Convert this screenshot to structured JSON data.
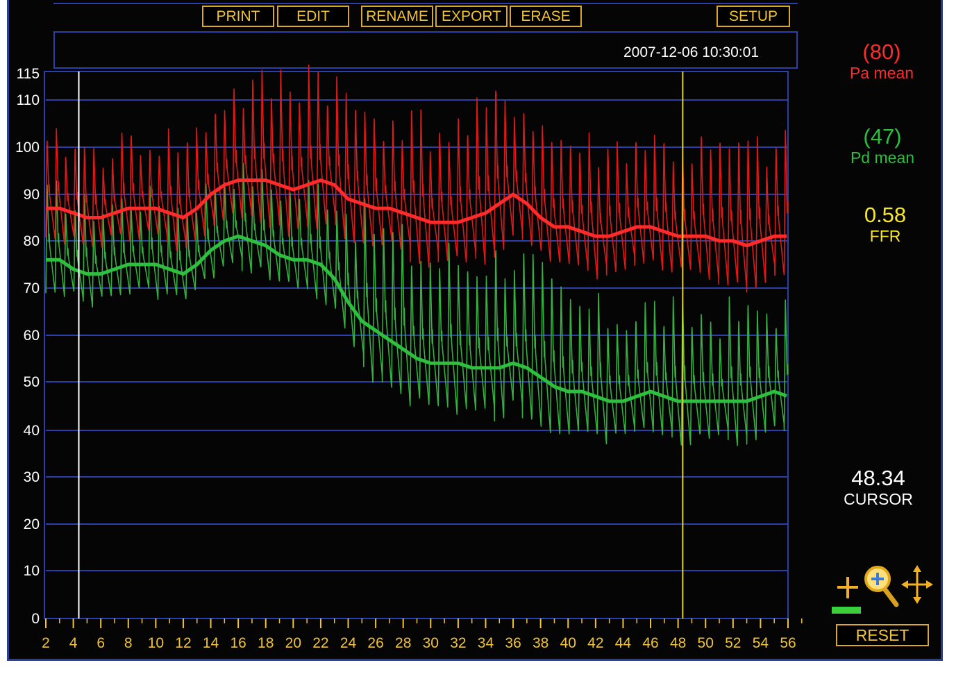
{
  "toolbar": {
    "print_label": "PRINT",
    "edit_label": "EDIT",
    "rename_label": "RENAME",
    "export_label": "EXPORT",
    "erase_label": "ERASE",
    "setup_label": "SETUP"
  },
  "header": {
    "timestamp": "2007-12-06 10:30:01"
  },
  "readouts": {
    "pa_value": "(80)",
    "pa_label": "Pa mean",
    "pd_value": "(47)",
    "pd_label": "Pd mean",
    "ffr_value": "0.58",
    "ffr_label": "FFR",
    "cursor_value": "48.34",
    "cursor_label": "CURSOR"
  },
  "controls": {
    "reset_label": "RESET",
    "zoom_in_icon": "plus-icon",
    "zoom_icon": "magnifier-icon",
    "pan_icon": "move-arrows-icon"
  },
  "colors": {
    "pa": "#ff2a2a",
    "pa_wave": "#e01818",
    "pd": "#2fbf3f",
    "pd_wave": "#35b040",
    "ffr": "#f5e82a",
    "accent": "#f2c336",
    "grid": "#2a3fa8"
  },
  "chart_data": {
    "type": "line",
    "x_ticks": [
      "2",
      "4",
      "6",
      "8",
      "10",
      "12",
      "14",
      "16",
      "18",
      "20",
      "22",
      "24",
      "26",
      "28",
      "30",
      "32",
      "34",
      "36",
      "38",
      "40",
      "42",
      "44",
      "46",
      "48",
      "50",
      "52",
      "54",
      "56"
    ],
    "y_ticks": [
      "0",
      "10",
      "20",
      "30",
      "40",
      "50",
      "60",
      "70",
      "80",
      "90",
      "100",
      "110",
      "115"
    ],
    "xlim": [
      2,
      56
    ],
    "ylim": [
      0,
      115
    ],
    "grid": true,
    "white_cursor_x": 4.4,
    "yellow_cursor_x": 48.34,
    "series": [
      {
        "name": "Pa mean",
        "x": [
          2,
          3,
          4,
          5,
          6,
          7,
          8,
          9,
          10,
          11,
          12,
          13,
          14,
          15,
          16,
          17,
          18,
          19,
          20,
          21,
          22,
          23,
          24,
          25,
          26,
          27,
          28,
          29,
          30,
          31,
          32,
          33,
          34,
          35,
          36,
          37,
          38,
          39,
          40,
          41,
          42,
          43,
          44,
          45,
          46,
          47,
          48,
          49,
          50,
          51,
          52,
          53,
          54,
          55,
          56
        ],
        "y": [
          87,
          87,
          86,
          85,
          85,
          86,
          87,
          87,
          87,
          86,
          85,
          87,
          90,
          92,
          93,
          93,
          93,
          92,
          91,
          92,
          93,
          92,
          89,
          88,
          87,
          87,
          86,
          85,
          84,
          84,
          84,
          85,
          86,
          88,
          90,
          88,
          85,
          83,
          83,
          82,
          81,
          81,
          82,
          83,
          83,
          82,
          81,
          81,
          81,
          80,
          80,
          79,
          80,
          81,
          81
        ],
        "wave_amplitude": [
          9,
          10,
          10,
          10,
          10,
          10,
          10,
          10,
          10,
          11,
          11,
          11,
          12,
          13,
          13,
          13,
          14,
          15,
          16,
          17,
          16,
          15,
          14,
          14,
          14,
          14,
          14,
          14,
          14,
          14,
          14,
          14,
          15,
          15,
          15,
          14,
          14,
          13,
          13,
          13,
          13,
          13,
          13,
          13,
          13,
          13,
          13,
          13,
          13,
          13,
          14,
          14,
          14,
          13,
          13
        ]
      },
      {
        "name": "Pd mean",
        "x": [
          2,
          3,
          4,
          5,
          6,
          7,
          8,
          9,
          10,
          11,
          12,
          13,
          14,
          15,
          16,
          17,
          18,
          19,
          20,
          21,
          22,
          23,
          24,
          25,
          26,
          27,
          28,
          29,
          30,
          31,
          32,
          33,
          34,
          35,
          36,
          37,
          38,
          39,
          40,
          41,
          42,
          43,
          44,
          45,
          46,
          47,
          48,
          49,
          50,
          51,
          52,
          53,
          54,
          55,
          56
        ],
        "y": [
          76,
          76,
          74,
          73,
          73,
          74,
          75,
          75,
          75,
          74,
          73,
          75,
          78,
          80,
          81,
          80,
          79,
          77,
          76,
          76,
          75,
          72,
          67,
          63,
          61,
          59,
          57,
          55,
          54,
          54,
          54,
          53,
          53,
          53,
          54,
          53,
          51,
          49,
          48,
          48,
          47,
          46,
          46,
          47,
          48,
          47,
          46,
          46,
          46,
          46,
          46,
          46,
          47,
          48,
          47
        ],
        "wave_amplitude": [
          10,
          10,
          10,
          10,
          10,
          10,
          10,
          10,
          10,
          10,
          10,
          10,
          10,
          10,
          10,
          10,
          10,
          10,
          10,
          11,
          12,
          13,
          14,
          15,
          16,
          16,
          16,
          16,
          16,
          16,
          16,
          16,
          17,
          17,
          17,
          16,
          15,
          14,
          13,
          13,
          13,
          13,
          13,
          13,
          13,
          13,
          13,
          13,
          13,
          13,
          13,
          13,
          13,
          13,
          13
        ]
      }
    ]
  }
}
